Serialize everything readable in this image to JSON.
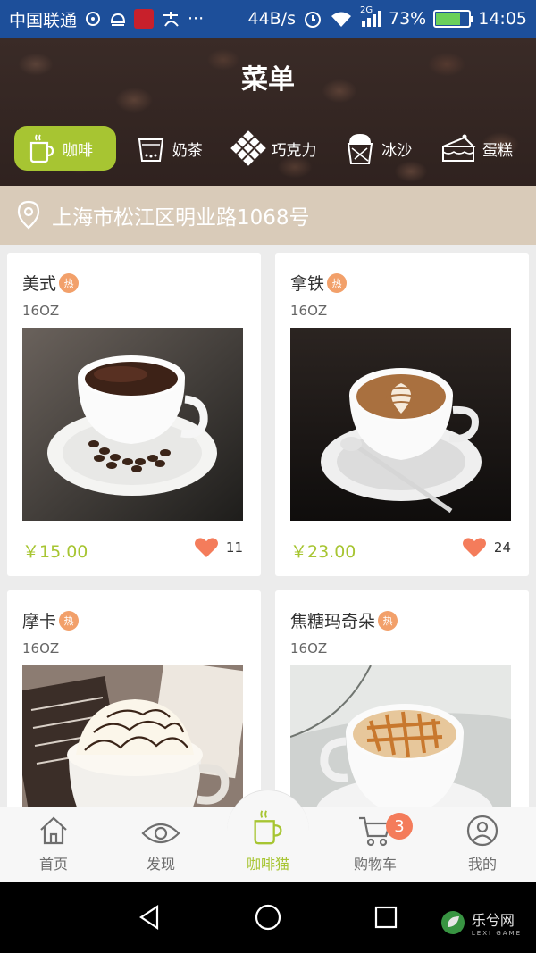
{
  "status_bar": {
    "carrier": "中国联通",
    "speed": "44B/s",
    "network": "2G",
    "battery_percent": "73%",
    "battery_level": 0.73,
    "time": "14:05"
  },
  "header": {
    "title": "菜单"
  },
  "categories": [
    {
      "label": "咖啡",
      "icon": "coffee-cup-icon",
      "active": true
    },
    {
      "label": "奶茶",
      "icon": "milk-tea-icon",
      "active": false
    },
    {
      "label": "巧克力",
      "icon": "chocolate-icon",
      "active": false
    },
    {
      "label": "冰沙",
      "icon": "smoothie-icon",
      "active": false
    },
    {
      "label": "蛋糕",
      "icon": "cake-icon",
      "active": false
    }
  ],
  "address": {
    "text": "上海市松江区明业路1068号",
    "icon": "location-pin-icon"
  },
  "products": [
    {
      "name": "美式",
      "hot_label": "热",
      "size": "16OZ",
      "price": "￥15.00",
      "likes": "11",
      "photo": "americano-photo"
    },
    {
      "name": "拿铁",
      "hot_label": "热",
      "size": "16OZ",
      "price": "￥23.00",
      "likes": "24",
      "photo": "latte-photo"
    },
    {
      "name": "摩卡",
      "hot_label": "热",
      "size": "16OZ",
      "price": "",
      "likes": "",
      "photo": "mocha-photo"
    },
    {
      "name": "焦糖玛奇朵",
      "hot_label": "热",
      "size": "16OZ",
      "price": "",
      "likes": "",
      "photo": "caramel-macchiato-photo"
    }
  ],
  "tabbar": {
    "items": [
      {
        "label": "首页",
        "icon": "home-icon"
      },
      {
        "label": "发现",
        "icon": "eye-icon"
      },
      {
        "label": "咖啡猫",
        "icon": "coffee-cup-icon",
        "active": true
      },
      {
        "label": "购物车",
        "icon": "cart-icon",
        "badge": "3"
      },
      {
        "label": "我的",
        "icon": "user-icon"
      }
    ]
  },
  "watermark": {
    "text": "乐兮网",
    "sub": "LEXI GAME"
  },
  "colors": {
    "accent_green": "#a7c532",
    "price_green": "#a7c532",
    "heart_orange": "#f47c5b",
    "hot_badge": "#f2a06a",
    "address_bg": "#d9cbb9",
    "status_bar_bg": "#1d4f9a"
  }
}
